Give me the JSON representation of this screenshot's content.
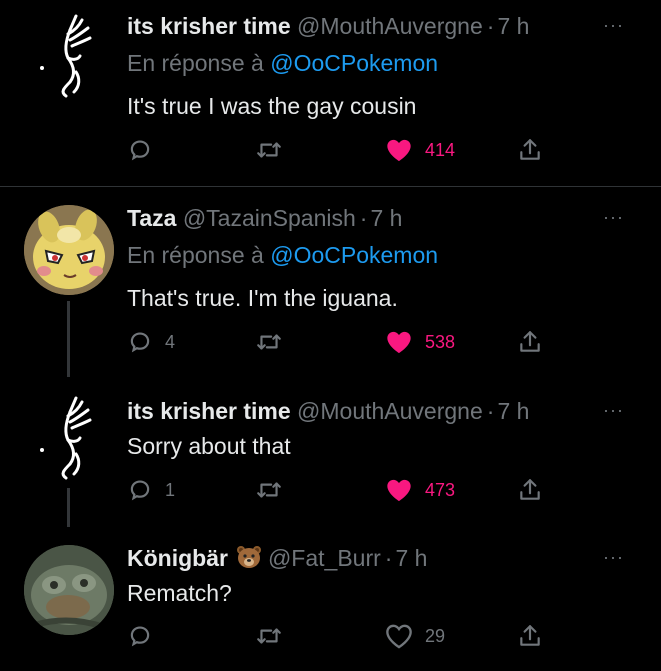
{
  "tweets": [
    {
      "author": "its krisher time",
      "handle": "@MouthAuvergne",
      "time": "7 h",
      "reply_prefix": "En réponse à",
      "reply_mention": "@OoCPokemon",
      "text": "It's true I was the gay cousin",
      "replies": "",
      "retweets": "",
      "likes": "414",
      "liked": true,
      "avatar_icon": "hand-sketch-avatar"
    },
    {
      "author": "Taza",
      "handle": "@TazainSpanish",
      "time": "7 h",
      "reply_prefix": "En réponse à",
      "reply_mention": "@OoCPokemon",
      "text": "That's true. I'm the iguana.",
      "replies": "4",
      "retweets": "",
      "likes": "538",
      "liked": true,
      "avatar_icon": "pokemon-face-avatar"
    },
    {
      "author": "its krisher time",
      "handle": "@MouthAuvergne",
      "time": "7 h",
      "text": "Sorry about that",
      "replies": "1",
      "retweets": "",
      "likes": "473",
      "liked": true,
      "avatar_icon": "hand-sketch-avatar"
    },
    {
      "author": "Königbär",
      "author_emoji": "bear-face-emoji",
      "handle": "@Fat_Burr",
      "time": "7 h",
      "text": "Rematch?",
      "replies": "",
      "retweets": "",
      "likes": "29",
      "liked": false,
      "avatar_icon": "toad-photo-avatar"
    }
  ],
  "colors": {
    "background": "#000000",
    "text": "#e7e9ea",
    "muted": "#71767b",
    "link": "#1d9bf0",
    "like": "#f91880",
    "divider": "#2f3336"
  },
  "separator": "·",
  "more_glyph": "···"
}
